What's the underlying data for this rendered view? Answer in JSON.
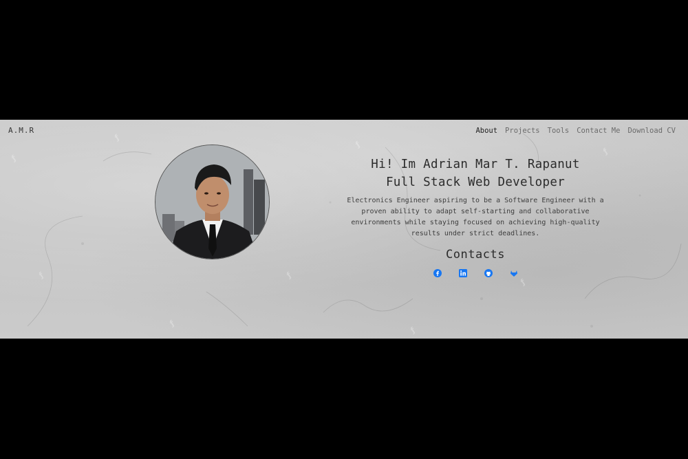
{
  "brand": "A.M.R",
  "nav": {
    "items": [
      "About",
      "Projects",
      "Tools",
      "Contact Me",
      "Download CV"
    ],
    "active": "About"
  },
  "hero": {
    "greeting": "Hi! Im Adrian Mar T. Rapanut",
    "role": "Full Stack Web Developer",
    "bio": "Electronics Engineer aspiring to be a Software Engineer with a proven ability to adapt self-starting and collaborative environments while staying focused on achieving high-quality results under strict deadlines."
  },
  "contacts": {
    "title": "Contacts",
    "icons": [
      "facebook-icon",
      "linkedin-icon",
      "github-icon",
      "gitlab-icon"
    ],
    "icon_color": "#1877f2"
  },
  "colors": {
    "background_outer": "#000000",
    "concrete": "#c7c7c7",
    "text": "#2b2b2b",
    "nav_inactive": "#6a6a6a"
  }
}
